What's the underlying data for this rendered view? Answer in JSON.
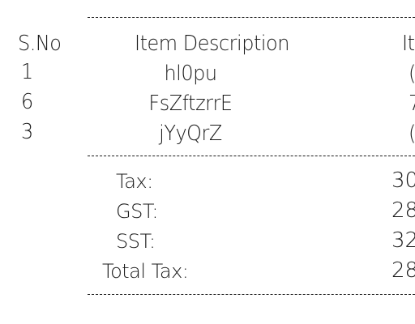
{
  "header": {
    "sno": "S.No",
    "item_description": "Item Description",
    "item_col_partial": "It"
  },
  "rows": [
    {
      "sno": "1",
      "description": "hl0pu",
      "partial": "("
    },
    {
      "sno": "6",
      "description": "FsZftzrrE",
      "partial": "7"
    },
    {
      "sno": "3",
      "description": "jYyQrZ",
      "partial": "("
    }
  ],
  "summary": [
    {
      "label": "Tax:",
      "value": "30"
    },
    {
      "label": "GST:",
      "value": "28"
    },
    {
      "label": "SST:",
      "value": "32"
    },
    {
      "label": "Total Tax:",
      "value": "28"
    }
  ]
}
